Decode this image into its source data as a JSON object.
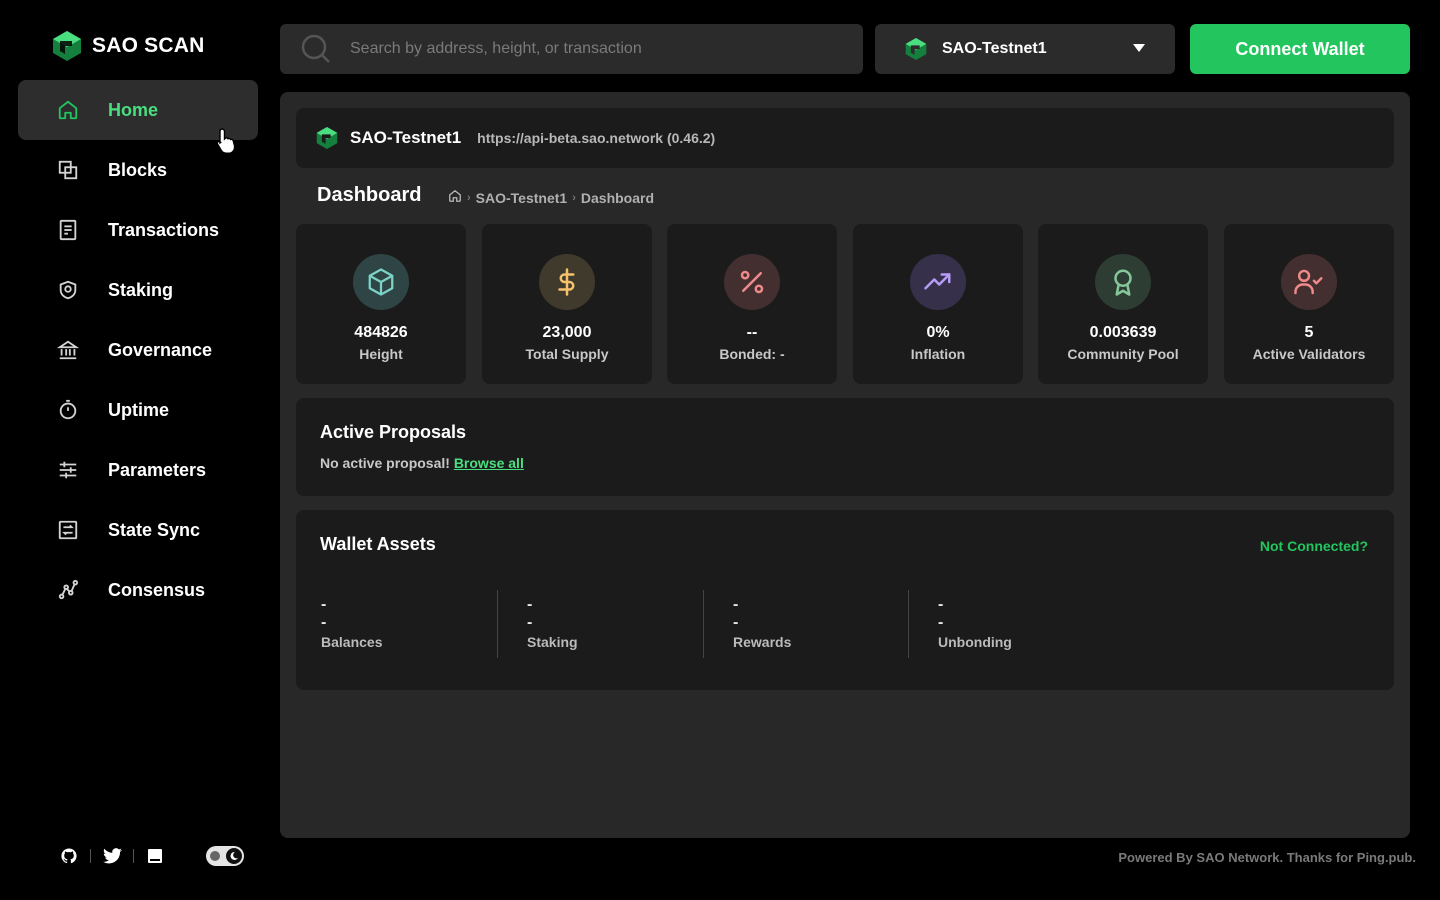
{
  "brand": {
    "name": "SAO SCAN",
    "accent": "#22c55e"
  },
  "sidebar": {
    "items": [
      {
        "label": "Home",
        "icon": "home-icon",
        "active": true
      },
      {
        "label": "Blocks",
        "icon": "blocks-icon"
      },
      {
        "label": "Transactions",
        "icon": "transactions-icon"
      },
      {
        "label": "Staking",
        "icon": "staking-icon"
      },
      {
        "label": "Governance",
        "icon": "governance-icon"
      },
      {
        "label": "Uptime",
        "icon": "uptime-icon"
      },
      {
        "label": "Parameters",
        "icon": "parameters-icon"
      },
      {
        "label": "State Sync",
        "icon": "state-sync-icon"
      },
      {
        "label": "Consensus",
        "icon": "consensus-icon"
      }
    ],
    "footer_icons": [
      "github-icon",
      "twitter-icon",
      "docs-icon",
      "theme-toggle"
    ]
  },
  "search": {
    "placeholder": "Search by address, height, or transaction"
  },
  "chain_selector": {
    "selected": "SAO-Testnet1"
  },
  "connect_wallet": {
    "label": "Connect Wallet"
  },
  "chain_bar": {
    "name": "SAO-Testnet1",
    "url": "https://api-beta.sao.network (0.46.2)"
  },
  "page": {
    "title": "Dashboard",
    "breadcrumb": [
      "SAO-Testnet1",
      "Dashboard"
    ]
  },
  "stats": [
    {
      "value": "484826",
      "label": "Height",
      "icon": "cube-icon",
      "color": "#7dd3c8"
    },
    {
      "value": "23,000",
      "label": "Total Supply",
      "icon": "dollar-icon",
      "color": "#f5c16c"
    },
    {
      "value": "--",
      "label": "Bonded: -",
      "icon": "percent-icon",
      "color": "#f08a8a"
    },
    {
      "value": "0%",
      "label": "Inflation",
      "icon": "trending-up-icon",
      "color": "#b79cf5"
    },
    {
      "value": "0.003639",
      "label": "Community Pool",
      "icon": "award-icon",
      "color": "#86c79a"
    },
    {
      "value": "5",
      "label": "Active Validators",
      "icon": "user-check-icon",
      "color": "#f08a8a"
    }
  ],
  "proposals": {
    "title": "Active Proposals",
    "message": "No active proposal!",
    "link": "Browse all"
  },
  "wallet": {
    "title": "Wallet Assets",
    "not_connected": "Not Connected?",
    "assets": [
      {
        "value": "--",
        "label": "Balances"
      },
      {
        "value": "--",
        "label": "Staking"
      },
      {
        "value": "--",
        "label": "Rewards"
      },
      {
        "value": "--",
        "label": "Unbonding"
      }
    ]
  },
  "footer": {
    "text": "Powered By SAO Network. Thanks for Ping.pub."
  }
}
